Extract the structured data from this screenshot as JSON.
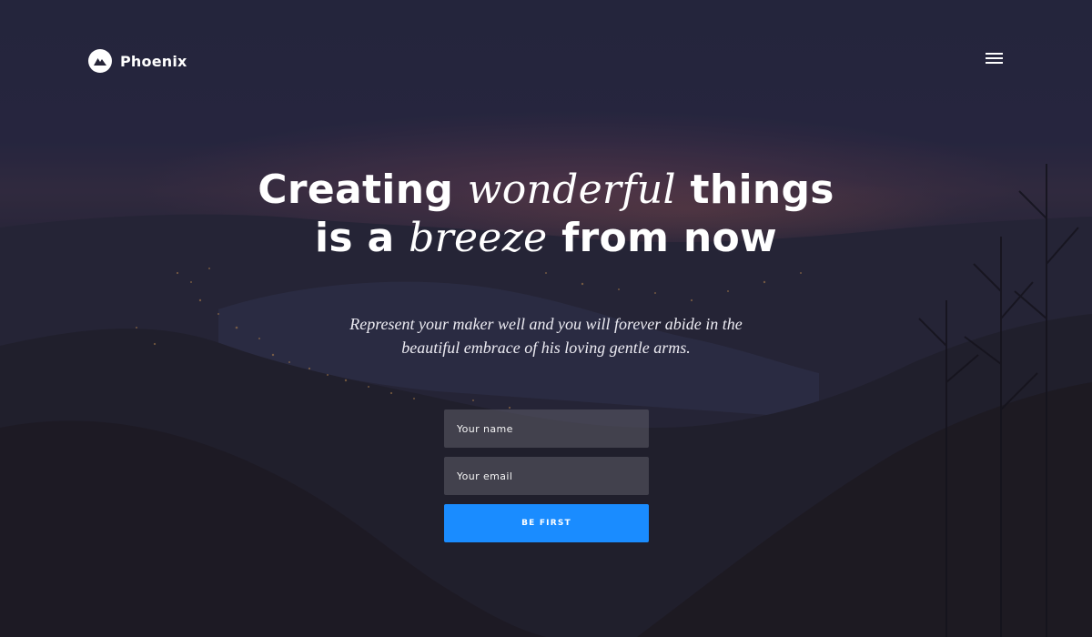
{
  "brand": {
    "name": "Phoenix",
    "logo_icon": "mountain-icon",
    "logo_bg": "#ffffff"
  },
  "nav": {
    "menu_icon": "hamburger-menu-icon"
  },
  "hero": {
    "line1_part1": "Creating",
    "line1_em": "wonderful",
    "line1_part2": "things",
    "line2_part1": "is a",
    "line2_em": "breeze",
    "line2_part2": "from now",
    "subtitle_line1": "Represent your maker well and you will forever abide in the",
    "subtitle_line2": "beautiful embrace of his loving gentle arms."
  },
  "signup": {
    "name_placeholder": "Your name",
    "name_value": "",
    "email_placeholder": "Your email",
    "email_value": "",
    "submit_label": "BE FIRST"
  },
  "colors": {
    "accent": "#1a8cff",
    "text": "#ffffff",
    "background": "#262538"
  }
}
